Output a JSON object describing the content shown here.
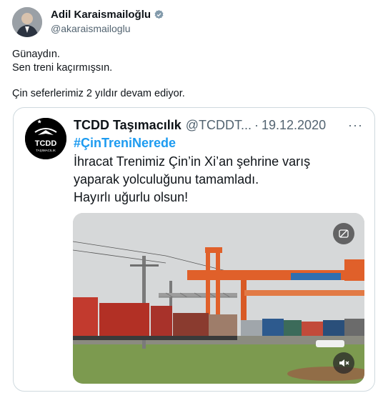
{
  "tweet": {
    "author_name": "Adil Karaismailoğlu",
    "handle": "@akaraismailoglu",
    "lines": [
      "Günaydın.",
      "Sen treni kaçırmışsın.",
      "Çin seferlerimiz 2 yıldır devam ediyor."
    ]
  },
  "quoted": {
    "author_name": "TCDD Taşımacılık",
    "handle": "@TCDDT...",
    "separator": "·",
    "date": "19.12.2020",
    "more": "···",
    "hashtag": "#ÇinTreniNerede",
    "lines": [
      "İhracat Trenimiz Çin’in Xi’an şehrine varış",
      "yaparak yolculuğunu tamamladı.",
      "Hayırlı uğurlu olsun!"
    ],
    "logo_text": "TCDD",
    "logo_subtext": "TAŞIMACILIK"
  },
  "media": {
    "icons": [
      "video-settings-icon",
      "mute-icon"
    ]
  },
  "colors": {
    "link_blue": "#1d9bf0",
    "verified": "#829aab",
    "secondary_text": "#536471",
    "border": "#cfd9de",
    "crane_orange": "#e0602a"
  }
}
